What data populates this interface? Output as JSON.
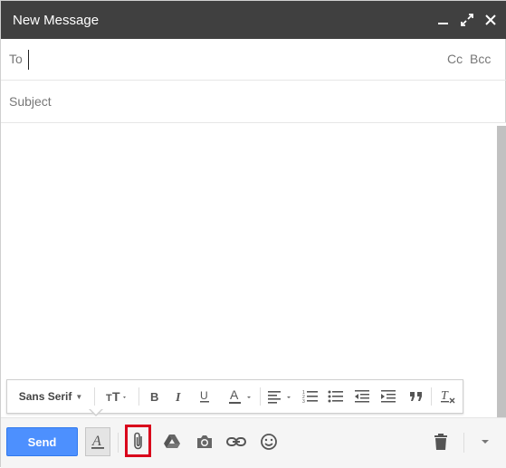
{
  "window": {
    "title": "New Message"
  },
  "recipients": {
    "to_label": "To",
    "to_value": "",
    "cc_label": "Cc",
    "bcc_label": "Bcc"
  },
  "subject": {
    "placeholder": "Subject",
    "value": ""
  },
  "body": {
    "value": ""
  },
  "formatting": {
    "font_label": "Sans Serif",
    "icons": [
      "text-size-icon",
      "bold-icon",
      "italic-icon",
      "underline-icon",
      "text-color-icon",
      "align-icon",
      "numbered-list-icon",
      "bulleted-list-icon",
      "indent-less-icon",
      "indent-more-icon",
      "quote-icon",
      "remove-formatting-icon"
    ]
  },
  "toolbar": {
    "send_label": "Send",
    "icons": [
      "formatting-options-icon",
      "attach-icon",
      "drive-icon",
      "photo-icon",
      "link-icon",
      "emoji-icon",
      "trash-icon",
      "more-options-icon"
    ],
    "highlight_color": "#d9001b",
    "send_color": "#4d90fe"
  }
}
